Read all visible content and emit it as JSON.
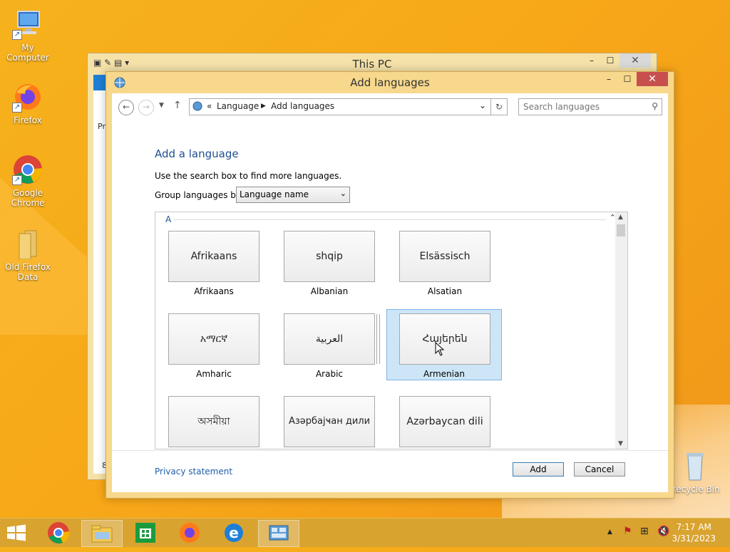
{
  "desktop": {
    "icons": [
      {
        "label": "My Computer"
      },
      {
        "label": "Firefox"
      },
      {
        "label": "Google Chrome"
      },
      {
        "label": "Old Firefox Data"
      },
      {
        "label": "Recycle Bin"
      }
    ]
  },
  "background_window": {
    "title": "This PC",
    "peek_text_pr": "Pr",
    "peek_text_8": "8"
  },
  "dialog": {
    "title": "Add languages",
    "breadcrumb": {
      "prefix": "«",
      "items": [
        "Language",
        "Add languages"
      ]
    },
    "search": {
      "placeholder": "Search languages"
    },
    "heading": "Add a language",
    "hint": "Use the search box to find more languages.",
    "group_label": "Group languages by:",
    "group_value": "Language name",
    "group_header": "A",
    "languages": [
      {
        "native": "Afrikaans",
        "name": "Afrikaans",
        "selected": false
      },
      {
        "native": "shqip",
        "name": "Albanian",
        "selected": false
      },
      {
        "native": "Elsässisch",
        "name": "Alsatian",
        "selected": false
      },
      {
        "native": "አማርኛ",
        "name": "Amharic",
        "selected": false
      },
      {
        "native": "العربية",
        "name": "Arabic",
        "selected": false
      },
      {
        "native": "Հայերեն",
        "name": "Armenian",
        "selected": true
      },
      {
        "native": "অসমীয়া",
        "name": "",
        "selected": false
      },
      {
        "native": "Азәрбајҹан дили",
        "name": "",
        "selected": false
      },
      {
        "native": "Azərbaycan dili",
        "name": "",
        "selected": false
      }
    ],
    "privacy_link": "Privacy statement",
    "add_label": "Add",
    "cancel_label": "Cancel"
  },
  "taskbar": {
    "time": "7:17 AM",
    "date": "3/31/2023"
  }
}
